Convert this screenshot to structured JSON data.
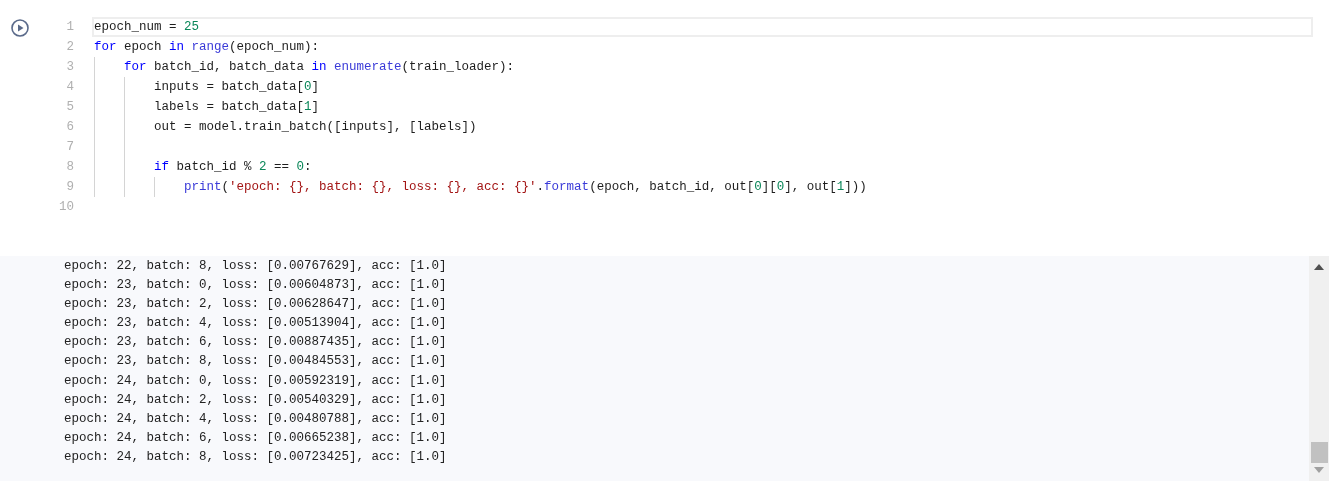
{
  "code_cell": {
    "lines": [
      {
        "number": "1",
        "selected": true,
        "tokens": [
          {
            "kind": "text",
            "text": "epoch_num = "
          },
          {
            "kind": "number",
            "text": "25"
          }
        ]
      },
      {
        "number": "2",
        "selected": false,
        "tokens": [
          {
            "kind": "keyword",
            "text": "for"
          },
          {
            "kind": "text",
            "text": " epoch "
          },
          {
            "kind": "keyword",
            "text": "in "
          },
          {
            "kind": "function",
            "text": "range"
          },
          {
            "kind": "text",
            "text": "(epoch_num):"
          }
        ],
        "children": [
          {
            "number": "3",
            "selected": false,
            "tokens": [
              {
                "kind": "keyword",
                "text": "for"
              },
              {
                "kind": "text",
                "text": " batch_id, batch_data "
              },
              {
                "kind": "keyword",
                "text": "in "
              },
              {
                "kind": "function",
                "text": "enumerate"
              },
              {
                "kind": "text",
                "text": "(train_loader):"
              }
            ],
            "children": [
              {
                "number": "4",
                "selected": false,
                "tokens": [
                  {
                    "kind": "text",
                    "text": "inputs = batch_data["
                  },
                  {
                    "kind": "number",
                    "text": "0"
                  },
                  {
                    "kind": "text",
                    "text": "]"
                  }
                ]
              },
              {
                "number": "5",
                "selected": false,
                "tokens": [
                  {
                    "kind": "text",
                    "text": "labels = batch_data["
                  },
                  {
                    "kind": "number",
                    "text": "1"
                  },
                  {
                    "kind": "text",
                    "text": "]"
                  }
                ]
              },
              {
                "number": "6",
                "selected": false,
                "tokens": [
                  {
                    "kind": "text",
                    "text": "out = model.train_batch([inputs], [labels])"
                  }
                ]
              },
              {
                "number": "7",
                "selected": false
              },
              {
                "number": "8",
                "selected": false,
                "tokens": [
                  {
                    "kind": "keyword",
                    "text": "if"
                  },
                  {
                    "kind": "text",
                    "text": " batch_id % "
                  },
                  {
                    "kind": "number",
                    "text": "2"
                  },
                  {
                    "kind": "text",
                    "text": " == "
                  },
                  {
                    "kind": "number",
                    "text": "0"
                  },
                  {
                    "kind": "text",
                    "text": ":"
                  }
                ],
                "children": [
                  {
                    "number": "9",
                    "selected": false,
                    "tokens": [
                      {
                        "kind": "function",
                        "text": "print"
                      },
                      {
                        "kind": "text",
                        "text": "("
                      },
                      {
                        "kind": "string",
                        "text": "'epoch: {}, batch: {}, loss: {}, acc: {}'"
                      },
                      {
                        "kind": "text",
                        "text": "."
                      },
                      {
                        "kind": "function",
                        "text": "format"
                      },
                      {
                        "kind": "text",
                        "text": "(epoch, batch_id, out["
                      },
                      {
                        "kind": "number",
                        "text": "0"
                      },
                      {
                        "kind": "text",
                        "text": "]["
                      },
                      {
                        "kind": "number",
                        "text": "0"
                      },
                      {
                        "kind": "text",
                        "text": "], out["
                      },
                      {
                        "kind": "number",
                        "text": "1"
                      },
                      {
                        "kind": "text",
                        "text": "]))"
                      }
                    ]
                  }
                ]
              }
            ]
          }
        ]
      },
      {
        "number": "10",
        "selected": false
      }
    ]
  },
  "output": {
    "lines": [
      "epoch: 22, batch: 8, loss: [0.00767629], acc: [1.0]",
      "epoch: 23, batch: 0, loss: [0.00604873], acc: [1.0]",
      "epoch: 23, batch: 2, loss: [0.00628647], acc: [1.0]",
      "epoch: 23, batch: 4, loss: [0.00513904], acc: [1.0]",
      "epoch: 23, batch: 6, loss: [0.00887435], acc: [1.0]",
      "epoch: 23, batch: 8, loss: [0.00484553], acc: [1.0]",
      "epoch: 24, batch: 0, loss: [0.00592319], acc: [1.0]",
      "epoch: 24, batch: 2, loss: [0.00540329], acc: [1.0]",
      "epoch: 24, batch: 4, loss: [0.00480788], acc: [1.0]",
      "epoch: 24, batch: 6, loss: [0.00665238], acc: [1.0]",
      "epoch: 24, batch: 8, loss: [0.00723425], acc: [1.0]"
    ]
  }
}
